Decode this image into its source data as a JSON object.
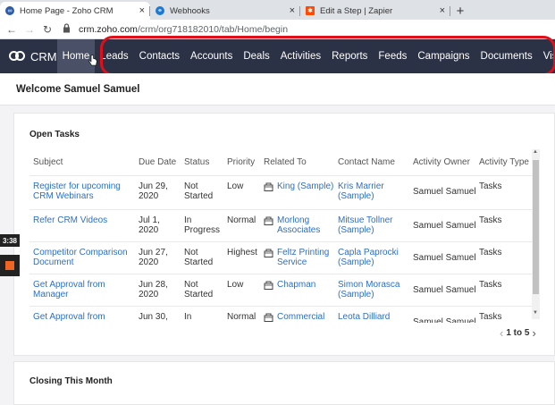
{
  "browser": {
    "tabs": [
      {
        "title": "Home Page - Zoho CRM",
        "favicon": "zoho-icon",
        "color": "#2c5ba8"
      },
      {
        "title": "Webhooks",
        "favicon": "webhooks-icon",
        "color": "#1b7bd4"
      },
      {
        "title": "Edit a Step | Zapier",
        "favicon": "zapier-icon",
        "color": "#ff4a00"
      }
    ],
    "close_glyph": "×",
    "new_tab_glyph": "+",
    "url_host": "crm.zoho.com",
    "url_path": "/crm/org718182010/tab/Home/begin"
  },
  "crm": {
    "logo_text": "CRM",
    "nav": [
      "Home",
      "Leads",
      "Contacts",
      "Accounts",
      "Deals",
      "Activities",
      "Reports",
      "Feeds",
      "Campaigns",
      "Documents",
      "Visits"
    ],
    "active_nav": "Home",
    "welcome": "Welcome Samuel Samuel"
  },
  "open_tasks": {
    "title": "Open Tasks",
    "columns": [
      "Subject",
      "Due Date",
      "Status",
      "Priority",
      "Related To",
      "Contact Name",
      "Activity Owner",
      "Activity Type"
    ],
    "rows": [
      {
        "subject": "Register for upcoming CRM Webinars",
        "due": "Jun 29, 2020",
        "status": "Not Started",
        "priority": "Low",
        "related": "King (Sample)",
        "related_icon": "account-icon",
        "contact": "Kris Marrier (Sample)",
        "owner": "Samuel Samuel",
        "type": "Tasks"
      },
      {
        "subject": "Refer CRM Videos",
        "due": "Jul 1, 2020",
        "status": "In Progress",
        "priority": "Normal",
        "related": "Morlong Associates",
        "related_icon": "account-icon",
        "contact": "Mitsue Tollner (Sample)",
        "owner": "Samuel Samuel",
        "type": "Tasks"
      },
      {
        "subject": "Competitor Comparison Document",
        "due": "Jun 27, 2020",
        "status": "Not Started",
        "priority": "Highest",
        "related": "Feltz Printing Service",
        "related_icon": "account-icon",
        "contact": "Capla Paprocki (Sample)",
        "owner": "Samuel Samuel",
        "type": "Tasks"
      },
      {
        "subject": "Get Approval from Manager",
        "due": "Jun 28, 2020",
        "status": "Not Started",
        "priority": "Low",
        "related": "Chapman",
        "related_icon": "account-icon",
        "contact": "Simon Morasca (Sample)",
        "owner": "Samuel Samuel",
        "type": "Tasks"
      },
      {
        "subject": "Get Approval from",
        "due": "Jun 30,",
        "status": "In",
        "priority": "Normal",
        "related": "Commercial",
        "related_icon": "account-icon",
        "contact": "Leota Dilliard",
        "owner": "Samuel Samuel",
        "type": "Tasks"
      }
    ],
    "pager_range": "1 to 5",
    "pager_prev": "‹",
    "pager_next": "›"
  },
  "closing": {
    "title": "Closing This Month"
  },
  "recorder": {
    "time": "3:38"
  },
  "colors": {
    "nav_bg": "#2c3246",
    "link": "#2a6fc9",
    "highlight": "#e0101a",
    "record": "#f06424"
  }
}
